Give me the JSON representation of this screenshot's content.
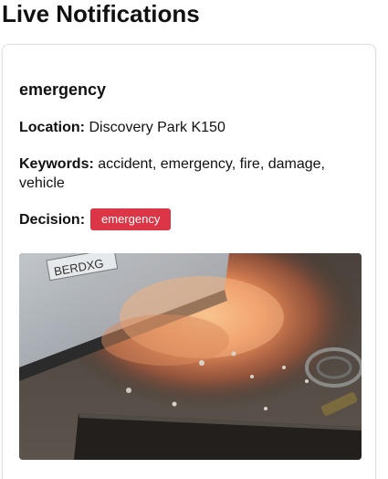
{
  "page": {
    "title": "Live Notifications"
  },
  "notification": {
    "title": "emergency",
    "location_label": "Location:",
    "location_value": "Discovery Park K150",
    "keywords_label": "Keywords:",
    "keywords_value": "accident, emergency, fire, damage, vehicle",
    "decision_label": "Decision:",
    "decision_value": "emergency",
    "decision_color": "#dc3545",
    "snapshot_plate": "BERDXG"
  }
}
